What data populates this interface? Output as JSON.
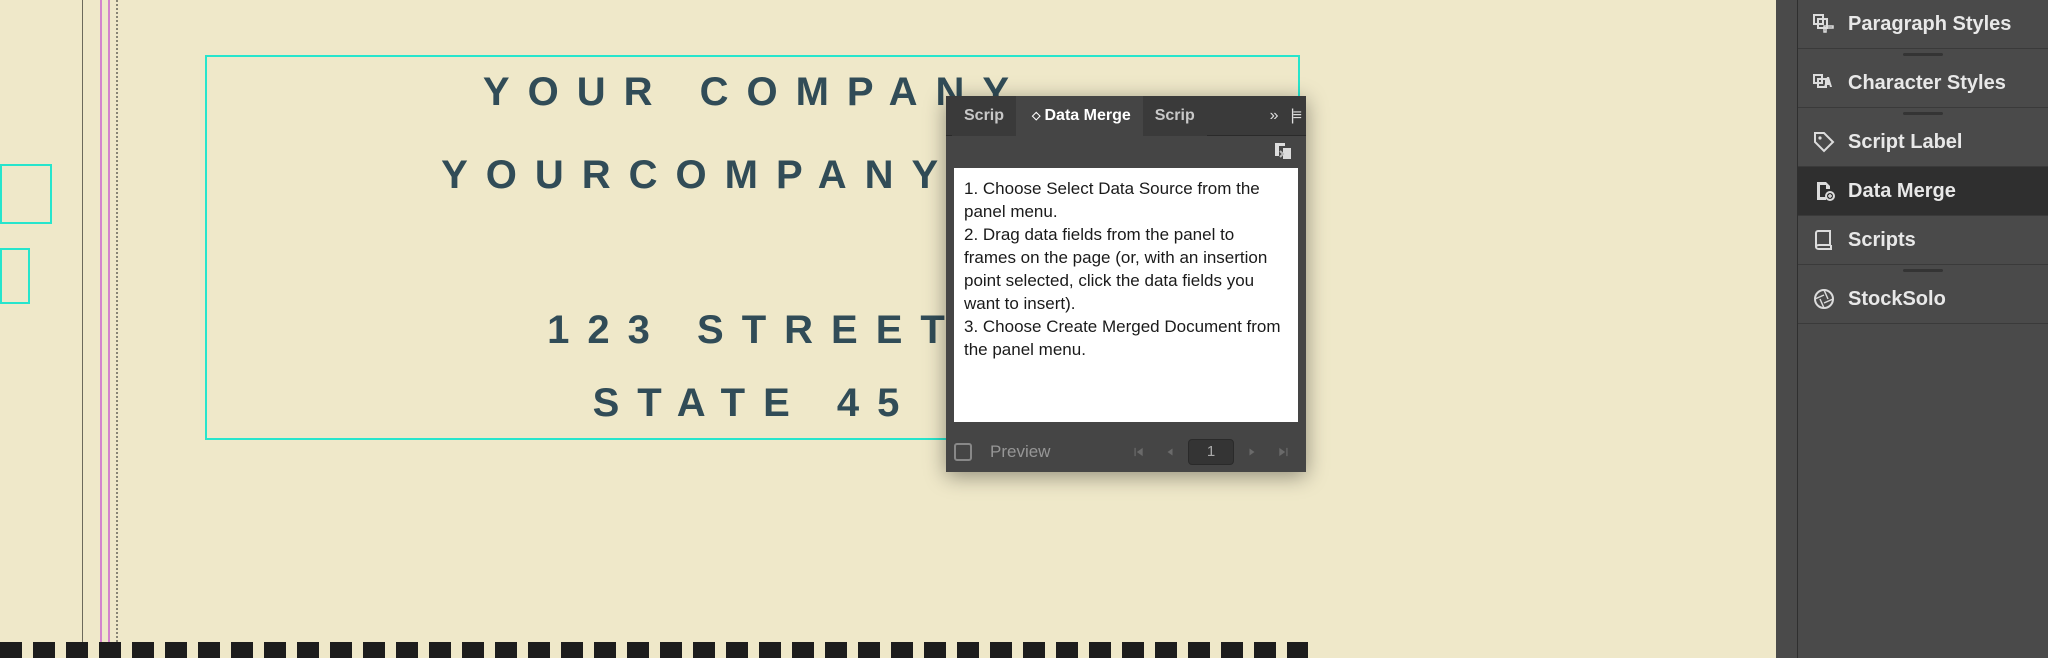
{
  "document": {
    "line1": "YOUR COMPANY",
    "line2": "YOURCOMPANY@W",
    "line3": "123 STREET",
    "line4": "STATE 45"
  },
  "panel": {
    "tabs": {
      "left_truncated": "Scrip",
      "active": "Data Merge",
      "right_truncated": "Scrip"
    },
    "body": {
      "step1": "1. Choose Select Data Source from the panel menu.",
      "step2": "2. Drag data fields from the panel to frames on the page (or, with an insertion point selected, click the data fields you want to insert).",
      "step3": "3. Choose Create Merged Document from the panel menu."
    },
    "footer": {
      "preview_label": "Preview",
      "page": "1"
    }
  },
  "dock": {
    "items": [
      "Paragraph Styles",
      "Character Styles",
      "Script Label",
      "Data Merge",
      "Scripts",
      "StockSolo"
    ],
    "active_index": 3
  }
}
